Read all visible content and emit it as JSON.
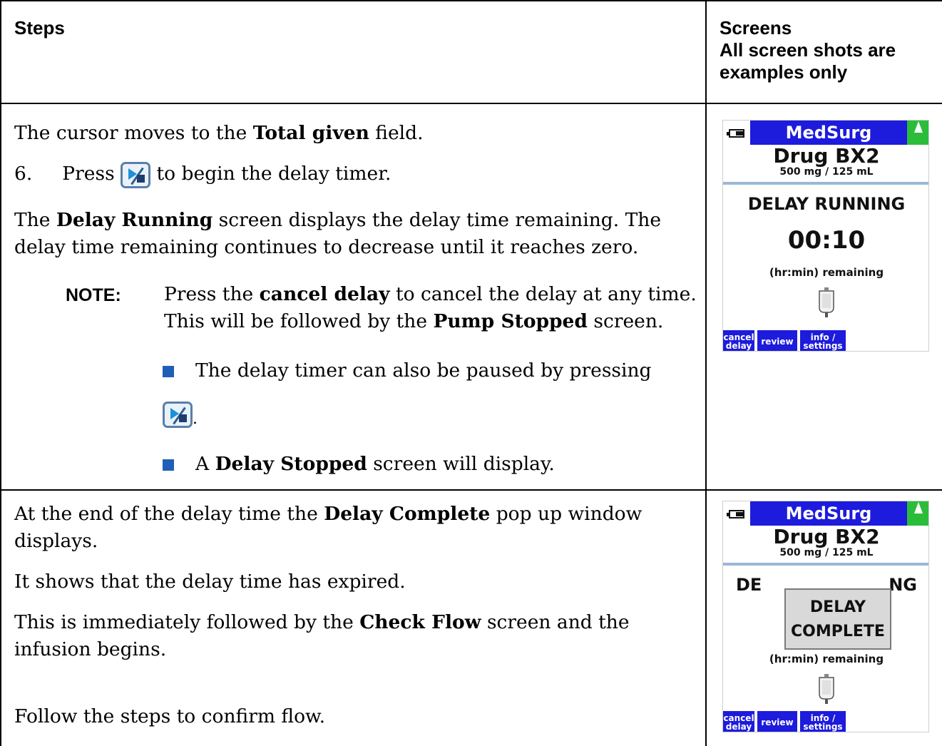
{
  "header": {
    "steps": "Steps",
    "screens_line1": "Screens",
    "screens_line2": "All screen shots are",
    "screens_line3": "examples only"
  },
  "row1": {
    "p1_pre": "The cursor moves to the ",
    "p1_bold": "Total given",
    "p1_post": " field.",
    "step_num": "6.",
    "step_pre": "Press ",
    "step_post": " to begin the delay timer.",
    "p2_pre": "The ",
    "p2_bold": "Delay Running",
    "p2_post": " screen displays the delay time remaining. The",
    "p2_line2": "delay time remaining continues to decrease until it reaches zero.",
    "note_label": "NOTE:",
    "note_l1_pre": "Press the ",
    "note_l1_bold": "cancel delay",
    "note_l1_post": " to cancel the delay at any time.",
    "note_l2_pre": "This will be followed by the ",
    "note_l2_bold": "Pump Stopped",
    "note_l2_post": " screen.",
    "bullet1": "The delay timer can also be paused by pressing",
    "bullet1_end": ".",
    "bullet2_pre": "A ",
    "bullet2_bold": "Delay Stopped",
    "bullet2_post": " screen will display."
  },
  "row2": {
    "p1_pre": "At the end of the delay time the ",
    "p1_bold": "Delay Complete",
    "p1_post": " pop up window",
    "p1_line2": "displays.",
    "p2": "It shows that the delay time has expired.",
    "p3_pre": "This is immediately followed by the ",
    "p3_bold": "Check Flow",
    "p3_post": " screen and the",
    "p3_line2": "infusion begins.",
    "p4": "Follow the steps to confirm flow."
  },
  "pump_screen": {
    "care_area": "MedSurg",
    "drug": "Drug BX2",
    "concentration": "500 mg / 125 mL",
    "status": "DELAY RUNNING",
    "time": "00:10",
    "remaining": "(hr:min) remaining",
    "softkey_1": "cancel delay",
    "softkey_2": "review",
    "softkey_3": "info / settings",
    "popup_line1": "DELAY",
    "popup_line2": "COMPLETE",
    "status_partial_left": "DE",
    "status_partial_right": "NG",
    "colors": {
      "title_bar": "#1d1bdc",
      "signal": "#2bbd3a"
    }
  }
}
